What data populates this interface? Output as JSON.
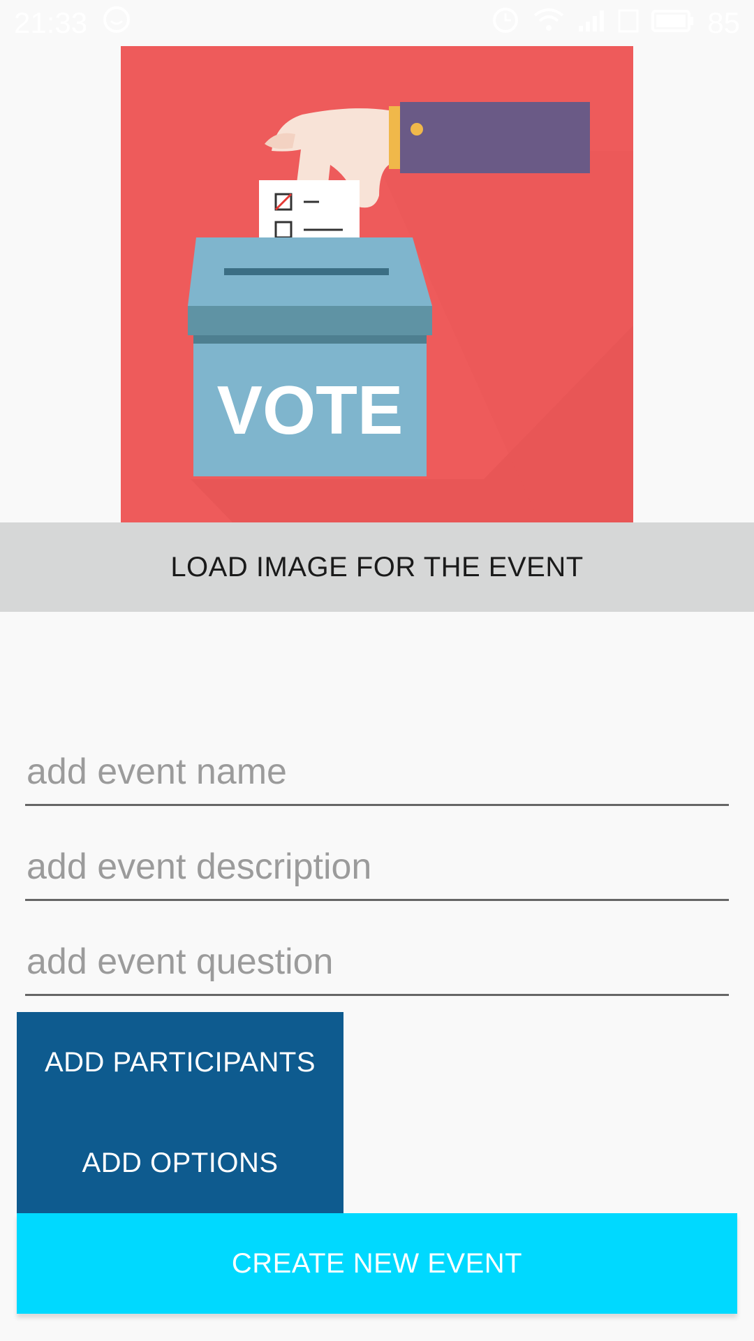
{
  "status_bar": {
    "time": "21:33",
    "battery": "85",
    "icons": [
      "notification-face-icon",
      "alarm-icon",
      "wifi-icon",
      "signal-icon",
      "signal-4g-icon",
      "battery-icon"
    ]
  },
  "event_image": {
    "alt": "vote illustration",
    "box_label": "VOTE",
    "colors": {
      "background": "#ee5b5b",
      "box": "#7fb5cd",
      "sleeve": "#6a5a86"
    }
  },
  "load_image_button": {
    "label": "LOAD IMAGE FOR THE EVENT"
  },
  "form": {
    "name_placeholder": "add event name",
    "description_placeholder": "add event description",
    "question_placeholder": "add event question"
  },
  "buttons": {
    "add_participants": "ADD PARTICIPANTS",
    "add_options": "ADD OPTIONS",
    "create_event": "CREATE NEW EVENT"
  },
  "colors": {
    "primary_dark": "#0e5b8f",
    "accent": "#00d9ff",
    "neutral_button": "#d6d7d7"
  }
}
